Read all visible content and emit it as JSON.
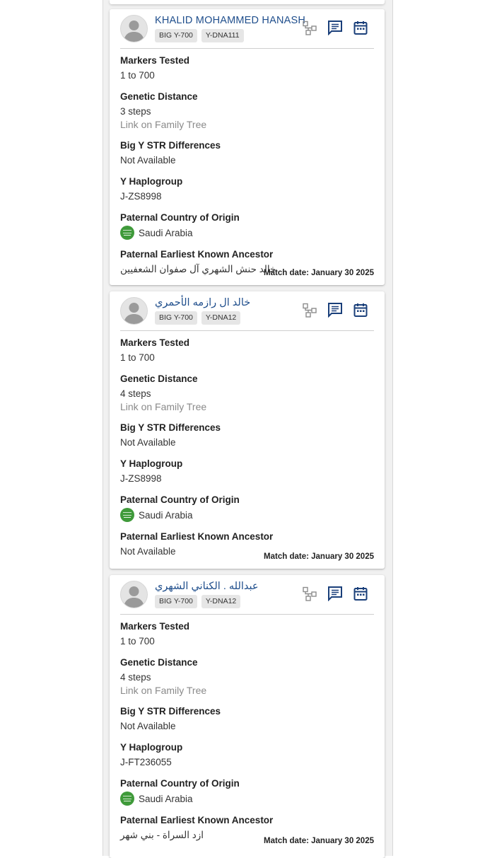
{
  "colors": {
    "name": "#1f4e8c",
    "icon": "#1a3f7a",
    "tree_icon": "#8c8c8c",
    "flag": "#3f9a3a"
  },
  "labels": {
    "markers": "Markers Tested",
    "distance": "Genetic Distance",
    "str": "Big Y STR Differences",
    "haplogroup": "Y Haplogroup",
    "country": "Paternal Country of Origin",
    "ancestor": "Paternal Earliest Known Ancestor"
  },
  "icons": [
    "family-tree-icon",
    "message-icon",
    "calendar-icon"
  ],
  "cards": [
    {
      "name": "KHALID MOHAMMED HANASH",
      "tests": [
        "BIG Y-700",
        "Y-DNA111"
      ],
      "markers": "1 to 700",
      "distance": "3 steps",
      "tree_link": "Link on Family Tree",
      "str": "Not Available",
      "haplogroup": "J-ZS8998",
      "country": "Saudi Arabia",
      "ancestor": "خالد حنش الشهري آل صفوان الشعفيين",
      "match_date": "Match date: January 30 2025"
    },
    {
      "name": "خالد ال رازمه الأحمري",
      "tests": [
        "BIG Y-700",
        "Y-DNA12"
      ],
      "markers": "1 to 700",
      "distance": "4 steps",
      "tree_link": "Link on Family Tree",
      "str": "Not Available",
      "haplogroup": "J-ZS8998",
      "country": "Saudi Arabia",
      "ancestor": "Not Available",
      "match_date": "Match date: January 30 2025"
    },
    {
      "name": "عبدالله . الكناني الشهري",
      "tests": [
        "BIG Y-700",
        "Y-DNA12"
      ],
      "markers": "1 to 700",
      "distance": "4 steps",
      "tree_link": "Link on Family Tree",
      "str": "Not Available",
      "haplogroup": "J-FT236055",
      "country": "Saudi Arabia",
      "ancestor": "ازد السراة - بني شهر",
      "match_date": "Match date: January 30 2025"
    }
  ]
}
